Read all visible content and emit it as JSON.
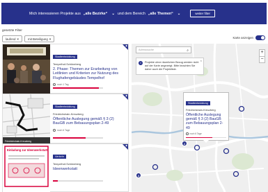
{
  "filter_bar": {
    "prefix": "Mich interessieren Projekte aus",
    "district_select": "„alle Bezirke“",
    "middle": "und dem Bereich",
    "theme_select": "„alle Themen“",
    "button": "weiter filter"
  },
  "selected_filters": {
    "label": "gesetzte Filter",
    "chips": [
      {
        "label": "laufend"
      },
      {
        "label": "mit Beteiligung"
      }
    ]
  },
  "map_toggle_label": "Karte anzeigen",
  "cards": [
    {
      "tag": "Stadtentwicklung",
      "district": "Tempelhof-Schöneberg",
      "title": "2. Phase: Themen zur Erarbeitung von Leitlinien und Kriterien zur Nutzung des Flughafengebäudes Tempelhof",
      "remaining": "noch 1 Tag",
      "progress": 0.92
    },
    {
      "tag": "Stadtentwicklung",
      "district": "Friedrichshain-Kreuzberg",
      "title": "Öffentliche Auslegung gemäß § 3 (2) BauGB zum Bebauungsplan 2-49",
      "remaining": "noch 6 Tage",
      "progress": 0.65,
      "thumb_caption": "Friedrichshain-Kreuzberg"
    },
    {
      "tag": "Verkehr",
      "district": "Tempelhof-Schöneberg",
      "title": "Ideenwerkstatt",
      "remaining": "",
      "progress": 0.1,
      "thumb_title": "Einladung zur Ideenwerkstatt"
    }
  ],
  "map": {
    "search_placeholder": "Adresssuche",
    "notice": "Projekte ohne räumlichen Bezug werden nicht auf der Karte angezeigt. Bitte beachten Sie daher auch die Projektliste.",
    "zoom_in": "+",
    "zoom_out": "−",
    "popup": {
      "tag": "Stadtentwicklung",
      "district": "Friedrichshain-Kreuzberg",
      "title": "Öffentliche Auslegung gemäß § 3 (2) BauGB zum Bebauungsplan 2-49",
      "remaining": "noch 6 Tage",
      "progress": 0.65
    },
    "clusters": [
      "2",
      "3"
    ]
  },
  "colors": {
    "primary": "#27318b",
    "accent": "#d9003b"
  }
}
